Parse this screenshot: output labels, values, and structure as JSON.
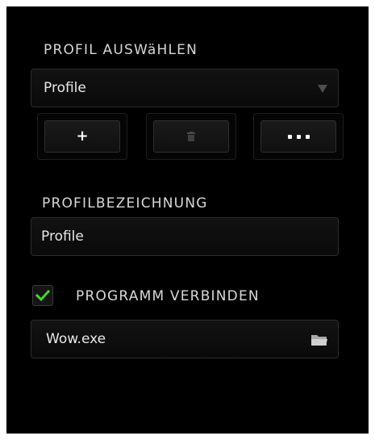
{
  "select_profile": {
    "heading": "PROFIL AUSWäHLEN",
    "selected_value": "Profile"
  },
  "profile_actions": {
    "add_label": "+",
    "delete_icon": "trash-icon",
    "more_icon": "more-dots-icon"
  },
  "profile_name": {
    "heading": "PROFILBEZEICHNUNG",
    "value": "Profile"
  },
  "link_program": {
    "checked": true,
    "label": "PROGRAMM VERBINDEN",
    "value": "Wow.exe",
    "browse_icon": "folder-icon"
  },
  "colors": {
    "panel_background": "#000000",
    "check_green": "#44d62c",
    "text": "#d7d7d7"
  }
}
